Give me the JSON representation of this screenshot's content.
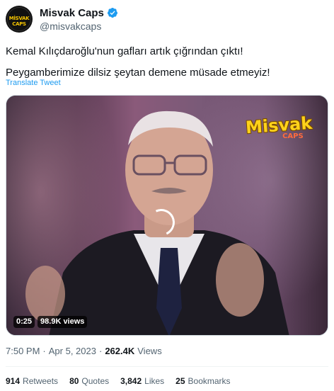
{
  "author": {
    "display_name": "Misvak Caps",
    "handle": "@misvakcaps",
    "avatar_text": "MİSVAK CAPS",
    "verified": true,
    "verified_color": "#1d9bf0"
  },
  "tweet": {
    "line1": "Kemal Kılıçdaroğlu'nun gafları artık çığrından çıktı!",
    "line2": "Peygamberimize dilsiz şeytan demene müsade etmeyiz!",
    "translate_label": "Translate Tweet"
  },
  "media": {
    "watermark_main": "Misvak",
    "watermark_sub": "CAPS",
    "duration": "0:25",
    "views": "98.9K views"
  },
  "meta": {
    "time": "7:50 PM",
    "separator": "·",
    "date": "Apr 5, 2023",
    "views_count": "262.4K",
    "views_label": "Views"
  },
  "stats": {
    "retweets_count": "914",
    "retweets_label": "Retweets",
    "quotes_count": "80",
    "quotes_label": "Quotes",
    "likes_count": "3,842",
    "likes_label": "Likes",
    "bookmarks_count": "25",
    "bookmarks_label": "Bookmarks"
  },
  "colors": {
    "link": "#1d9bf0",
    "muted": "#536471",
    "text": "#0f1419"
  }
}
